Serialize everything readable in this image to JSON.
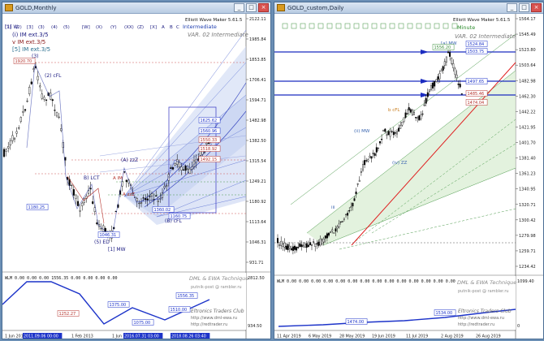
{
  "left": {
    "title": "GOLD,Monthly",
    "panel_label": "Elliott Wave Maker 5.61.5",
    "wave_degree": "Intermediate",
    "var_label": "VAR. 02 Intermediate",
    "corner_label": "[1] W",
    "top_markers": [
      "(1)",
      "(2)",
      "[3]",
      "(3)",
      "(4)",
      "(5)",
      "[W]",
      "(X)",
      "(Y)",
      "(XX)",
      "(Z)",
      "[X]",
      "A",
      "B",
      "C"
    ],
    "legend": [
      {
        "text": "(i) IM ext.3/5",
        "color": "#1a1a80"
      },
      {
        "text": "v IM ext.3/5",
        "color": "#8b1a1a"
      },
      {
        "text": "[5] IM ext.3/5",
        "color": "#2a6f8f"
      }
    ],
    "price_ticks": [
      "2122.11",
      "1985.84",
      "1853.85",
      "1706.41",
      "1594.71",
      "1482.98",
      "1382.50",
      "1315.54",
      "1249.21",
      "1180.92",
      "1113.64",
      "1046.31",
      "931.71"
    ],
    "chart_labels": [
      {
        "text": "1920.70",
        "kind": "box-red"
      },
      {
        "text": "(3)",
        "kind": "wave"
      },
      {
        "text": "(2) cFL",
        "kind": "wave"
      },
      {
        "text": "(A) zzZ",
        "kind": "wave"
      },
      {
        "text": "(B) cFL",
        "kind": "wave"
      },
      {
        "text": "(5) ED",
        "kind": "wave"
      },
      {
        "text": "[1] MW",
        "kind": "wave"
      },
      {
        "text": "A IM",
        "kind": "wave-red"
      },
      {
        "text": "A zzZ",
        "kind": "wave-red"
      },
      {
        "text": "B) LCT",
        "kind": "wave"
      },
      {
        "text": "1180.25",
        "kind": "box-blue"
      },
      {
        "text": "1360.02",
        "kind": "box-blue"
      },
      {
        "text": "1046.31",
        "kind": "box-blue"
      },
      {
        "text": "1160.75",
        "kind": "box-blue"
      }
    ],
    "box_values": [
      "1625.62",
      "1560.96",
      "1550.33",
      "1518.92",
      "1492.15"
    ],
    "x_ticks": [
      "1 Jun 2011",
      "2011.09.06 00:00",
      "1 Feb 2013",
      "1 Jun 2014",
      "2016.07.31 03:00",
      "2018.08.26 03:40"
    ],
    "indicator": {
      "header": "WLM 0.00 0.00 0.00 1556.35 0.00 0.00 0.00 0.00",
      "watermark": "DML & EWA Technique",
      "email": "putnik-post @ rambler.ru",
      "club": "Eltronics Traders Club",
      "site1": "http://www.dml-ewa.ru",
      "site2": "http://redtrader.ru",
      "ticks": [
        "2812.50",
        "934.50"
      ],
      "labels": [
        "1375.00",
        "1252.27",
        "1075.00",
        "1510.00",
        "1556.35"
      ]
    }
  },
  "right": {
    "title": "GOLD_custom,Daily",
    "panel_label": "Elliott Wave Maker 5.61.5",
    "wave_degree": "Minute",
    "var_label": "VAR. 02 Intermediate",
    "price_ticks": [
      "1564.17",
      "1545.49",
      "1523.80",
      "1503.64",
      "1482.98",
      "1462.30",
      "1442.22",
      "1421.95",
      "1401.70",
      "1381.40",
      "1361.23",
      "1340.95",
      "1320.71",
      "1300.42",
      "1279.98",
      "1259.71",
      "1234.42"
    ],
    "chart_labels": [
      {
        "text": "[a] MW",
        "kind": "wave"
      },
      {
        "text": "(ii) MW",
        "kind": "wave"
      },
      {
        "text": "b cFL",
        "kind": "wave-red"
      },
      {
        "text": "(iv) ZZ",
        "kind": "wave"
      },
      {
        "text": "iii",
        "kind": "wave"
      }
    ],
    "box_values": [
      "1556.20",
      "1524.84",
      "1503.75",
      "1497.65",
      "1485.46",
      "1474.04"
    ],
    "x_ticks": [
      "11 Apr 2019",
      "6 May 2019",
      "28 May 2019",
      "19 Jun 2019",
      "11 Jul 2019",
      "2 Aug 2019",
      "26 Aug 2019"
    ],
    "indicator": {
      "header": "WLM 0.00 0.00 0.00 0.00 0.00 0.00 0.00 0.00 0.00 0.00 0.00 0.00 0.00 0.00",
      "watermark": "DML & EWA Technique",
      "email": "putnik-post @ rambler.ru",
      "club": "Eltronics Traders Club",
      "site1": "http://www.dml-ewa.ru",
      "site2": "http://redtrader.ru",
      "ticks": [
        "1099.40",
        "0"
      ],
      "labels": [
        "1474.00",
        "1534.00"
      ]
    }
  },
  "chart_data": [
    {
      "type": "candlestick",
      "symbol": "GOLD",
      "timeframe": "Monthly",
      "ylim": [
        931.71,
        2122.11
      ],
      "key_levels": [
        1920.7,
        1625.62,
        1560.96,
        1550.33,
        1518.92,
        1492.15,
        1360.02,
        1180.25,
        1160.75,
        1046.31
      ],
      "x_range": [
        "2011-06",
        "2019-08"
      ],
      "grid": false
    },
    {
      "type": "candlestick",
      "symbol": "GOLD_custom",
      "timeframe": "Daily",
      "ylim": [
        1234.42,
        1564.17
      ],
      "key_levels": [
        1556.2,
        1524.84,
        1503.75,
        1497.65,
        1485.46,
        1474.04
      ],
      "x_range": [
        "2019-04-11",
        "2019-09-06"
      ],
      "grid": false
    }
  ]
}
